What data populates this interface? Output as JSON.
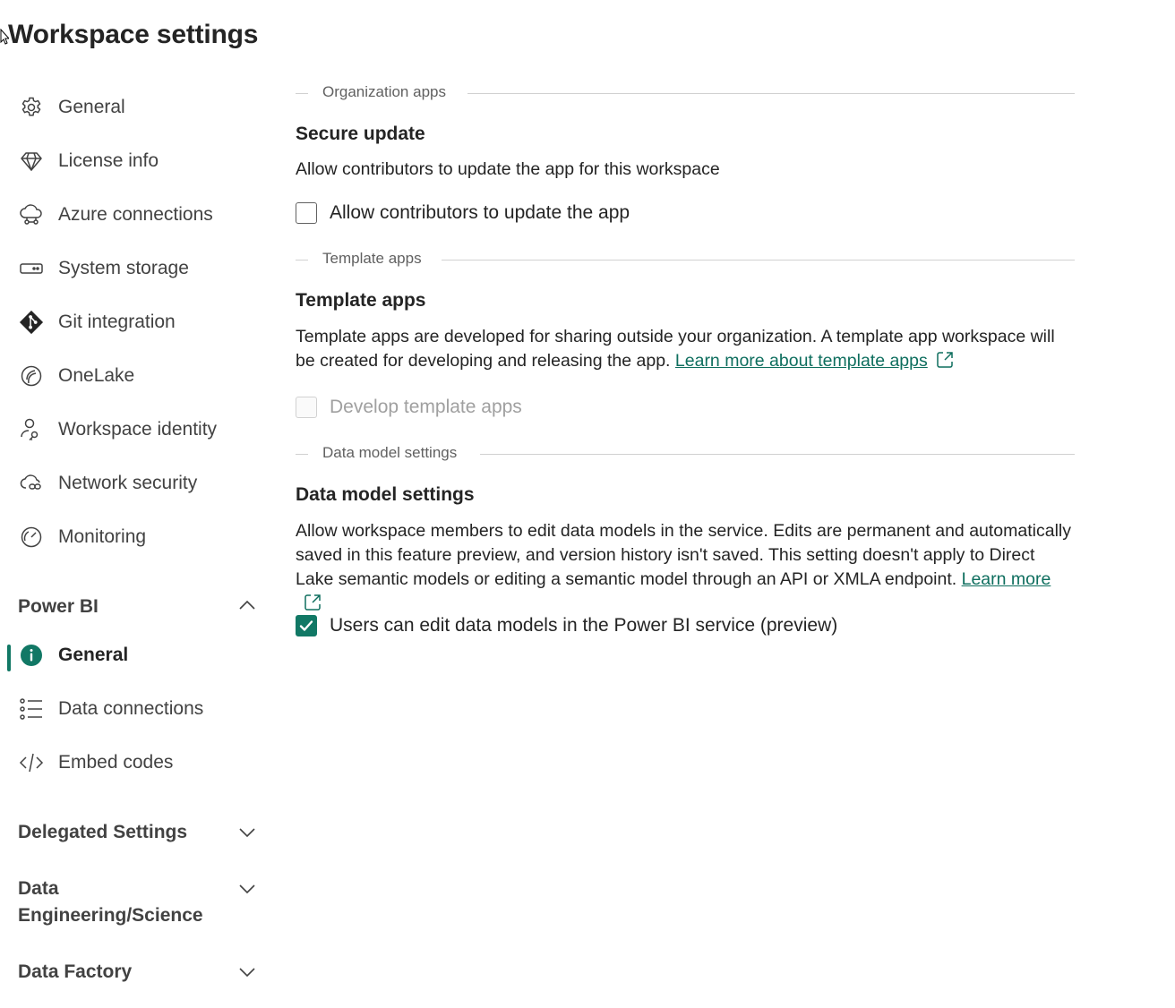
{
  "page": {
    "title": "Workspace settings"
  },
  "colors": {
    "accent": "#117865",
    "link": "#0e6e5e"
  },
  "sidebar": {
    "items": [
      {
        "label": "General",
        "icon": "gear-icon"
      },
      {
        "label": "License info",
        "icon": "diamond-icon"
      },
      {
        "label": "Azure connections",
        "icon": "cloud-connection-icon"
      },
      {
        "label": "System storage",
        "icon": "storage-icon"
      },
      {
        "label": "Git integration",
        "icon": "git-icon"
      },
      {
        "label": "OneLake",
        "icon": "onelake-icon"
      },
      {
        "label": "Workspace identity",
        "icon": "person-key-icon"
      },
      {
        "label": "Network security",
        "icon": "cloud-link-icon"
      },
      {
        "label": "Monitoring",
        "icon": "gauge-icon"
      }
    ],
    "sections": {
      "power_bi": {
        "label": "Power BI",
        "expanded": true,
        "items": [
          {
            "label": "General",
            "icon": "info-icon",
            "active": true
          },
          {
            "label": "Data connections",
            "icon": "list-icon"
          },
          {
            "label": "Embed codes",
            "icon": "code-icon"
          }
        ]
      },
      "delegated": {
        "label": "Delegated Settings",
        "expanded": false
      },
      "data_engineering": {
        "label": "Data Engineering/Science",
        "expanded": false
      },
      "data_factory": {
        "label": "Data Factory",
        "expanded": false
      }
    }
  },
  "main": {
    "org_apps": {
      "divider": "Organization apps",
      "heading": "Secure update",
      "description": "Allow contributors to update the app for this workspace",
      "checkbox_label": "Allow contributors to update the app",
      "checked": false
    },
    "template_apps": {
      "divider": "Template apps",
      "heading": "Template apps",
      "description": "Template apps are developed for sharing outside your organization. A template app workspace will be created for developing and releasing the app.",
      "link": "Learn more about template apps",
      "checkbox_label": "Develop template apps",
      "checked": false,
      "disabled": true
    },
    "data_model": {
      "divider": "Data model settings",
      "heading": "Data model settings",
      "description": "Allow workspace members to edit data models in the service. Edits are permanent and automatically saved in this feature preview, and version history isn't saved. This setting doesn't apply to Direct Lake semantic models or editing a semantic model through an API or XMLA endpoint.",
      "link": "Learn more",
      "checkbox_label": "Users can edit data models in the Power BI service (preview)",
      "checked": true
    }
  }
}
